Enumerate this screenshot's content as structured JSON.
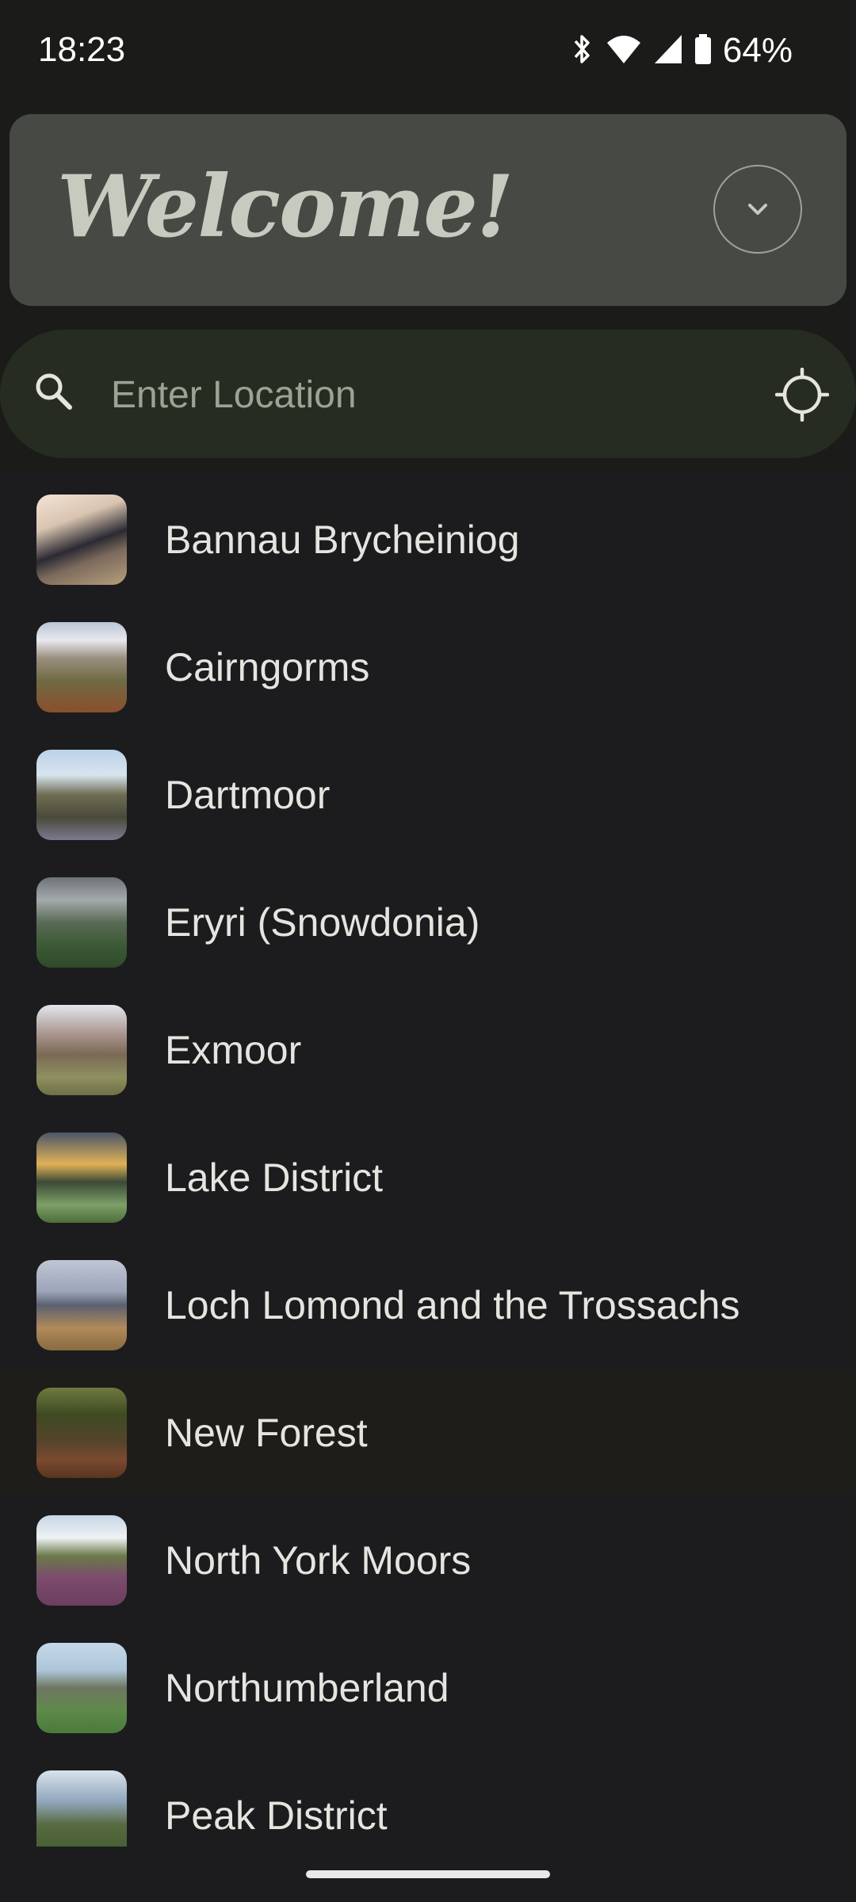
{
  "status_bar": {
    "time": "18:23",
    "battery": "64%",
    "icons": [
      "bluetooth-icon",
      "wifi-icon",
      "signal-icon",
      "battery-icon"
    ]
  },
  "header": {
    "title": "Welcome!",
    "expand_icon": "chevron-down-icon"
  },
  "search": {
    "placeholder": "Enter Location",
    "value": "",
    "search_icon": "search-icon",
    "locate_icon": "my-location-icon"
  },
  "parks": [
    {
      "name": "Bannau Brycheiniog"
    },
    {
      "name": "Cairngorms"
    },
    {
      "name": "Dartmoor"
    },
    {
      "name": "Eryri (Snowdonia)"
    },
    {
      "name": "Exmoor"
    },
    {
      "name": "Lake District"
    },
    {
      "name": "Loch Lomond and the Trossachs"
    },
    {
      "name": "New Forest",
      "selected": true
    },
    {
      "name": "North York Moors"
    },
    {
      "name": "Northumberland"
    },
    {
      "name": "Peak District"
    }
  ],
  "colors": {
    "background": "#1c1c1f",
    "welcome_card": "#474a44",
    "welcome_text": "#c7cbbf",
    "search_bar": "#262c22"
  }
}
